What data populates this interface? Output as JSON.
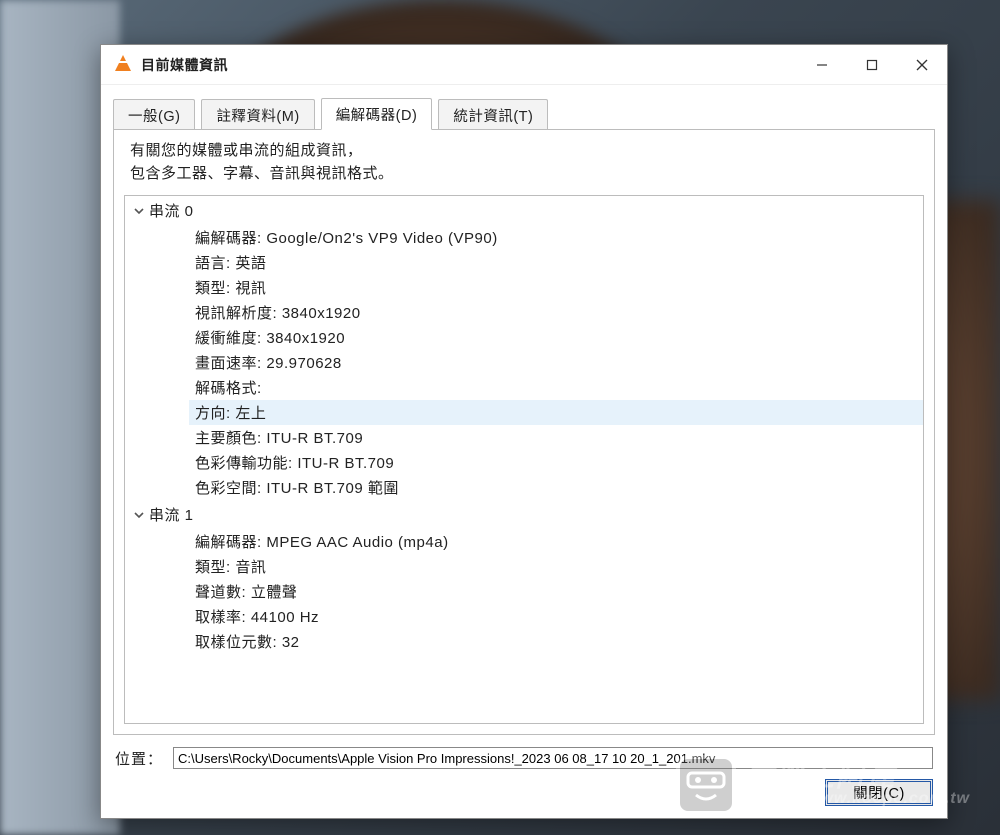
{
  "window": {
    "title": "目前媒體資訊"
  },
  "tabs": {
    "general": "一般(G)",
    "metadata": "註釋資料(M)",
    "codec": "編解碼器(D)",
    "stats": "統計資訊(T)"
  },
  "panel": {
    "info_line1": "有關您的媒體或串流的組成資訊，",
    "info_line2": "包含多工器、字幕、音訊與視訊格式。"
  },
  "streams": {
    "s0": {
      "title": "串流 0",
      "codec": "編解碼器: Google/On2's VP9 Video (VP90)",
      "language": "語言: 英語",
      "type": "類型: 視訊",
      "resolution": "視訊解析度: 3840x1920",
      "buffer": "緩衝維度: 3840x1920",
      "fps": "畫面速率: 29.970628",
      "decode_fmt": "解碼格式:",
      "orientation": "方向: 左上",
      "primary": "主要顏色: ITU-R BT.709",
      "transfer": "色彩傳輸功能: ITU-R BT.709",
      "colorspace": "色彩空間: ITU-R BT.709 範圍"
    },
    "s1": {
      "title": "串流 1",
      "codec": "編解碼器: MPEG AAC Audio (mp4a)",
      "type": "類型: 音訊",
      "channels": "聲道數: 立體聲",
      "samplerate": "取樣率: 44100 Hz",
      "bits": "取樣位元數: 32"
    }
  },
  "footer": {
    "location_label": "位置：",
    "location_value": "C:\\Users\\Rocky\\Documents\\Apple Vision Pro Impressions!_2023 06 08_17 10 20_1_201.mkv",
    "close_label": "關閉(C)"
  },
  "watermark": {
    "cn": "電腦王阿達",
    "url": "https://www.kocpc.com.tw"
  }
}
